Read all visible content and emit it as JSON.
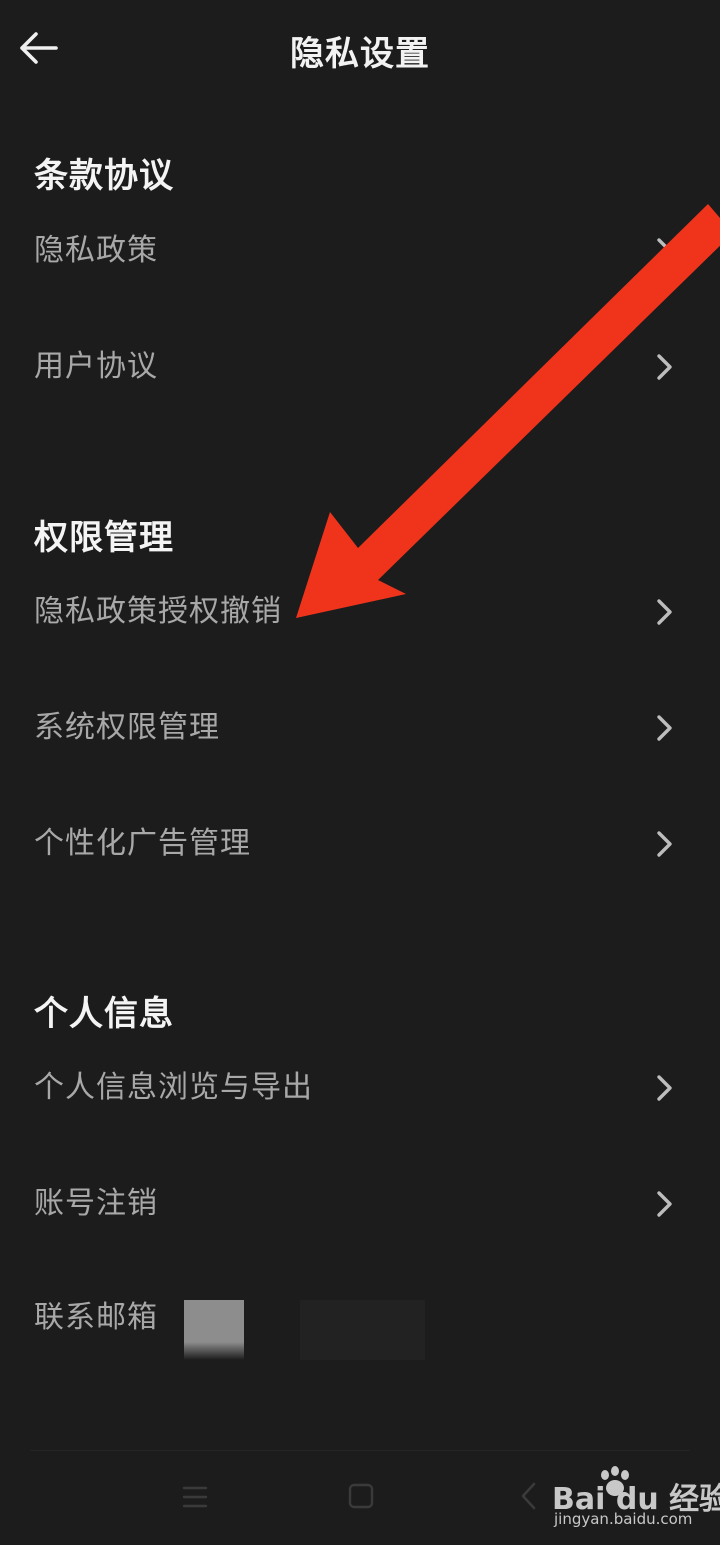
{
  "header": {
    "title": "隐私设置"
  },
  "sections": [
    {
      "title": "条款协议",
      "items": [
        {
          "label": "隐私政策"
        },
        {
          "label": "用户协议"
        }
      ]
    },
    {
      "title": "权限管理",
      "items": [
        {
          "label": "隐私政策授权撤销"
        },
        {
          "label": "系统权限管理"
        },
        {
          "label": "个性化广告管理"
        }
      ]
    },
    {
      "title": "个人信息",
      "items": [
        {
          "label": "个人信息浏览与导出"
        },
        {
          "label": "账号注销"
        },
        {
          "label": "联系邮箱"
        }
      ]
    }
  ],
  "watermark": {
    "logo": "Bai du 经验",
    "url": "jingyan.baidu.com"
  },
  "colors": {
    "background": "#1c1c1c",
    "annotation_arrow": "#f0341c"
  }
}
